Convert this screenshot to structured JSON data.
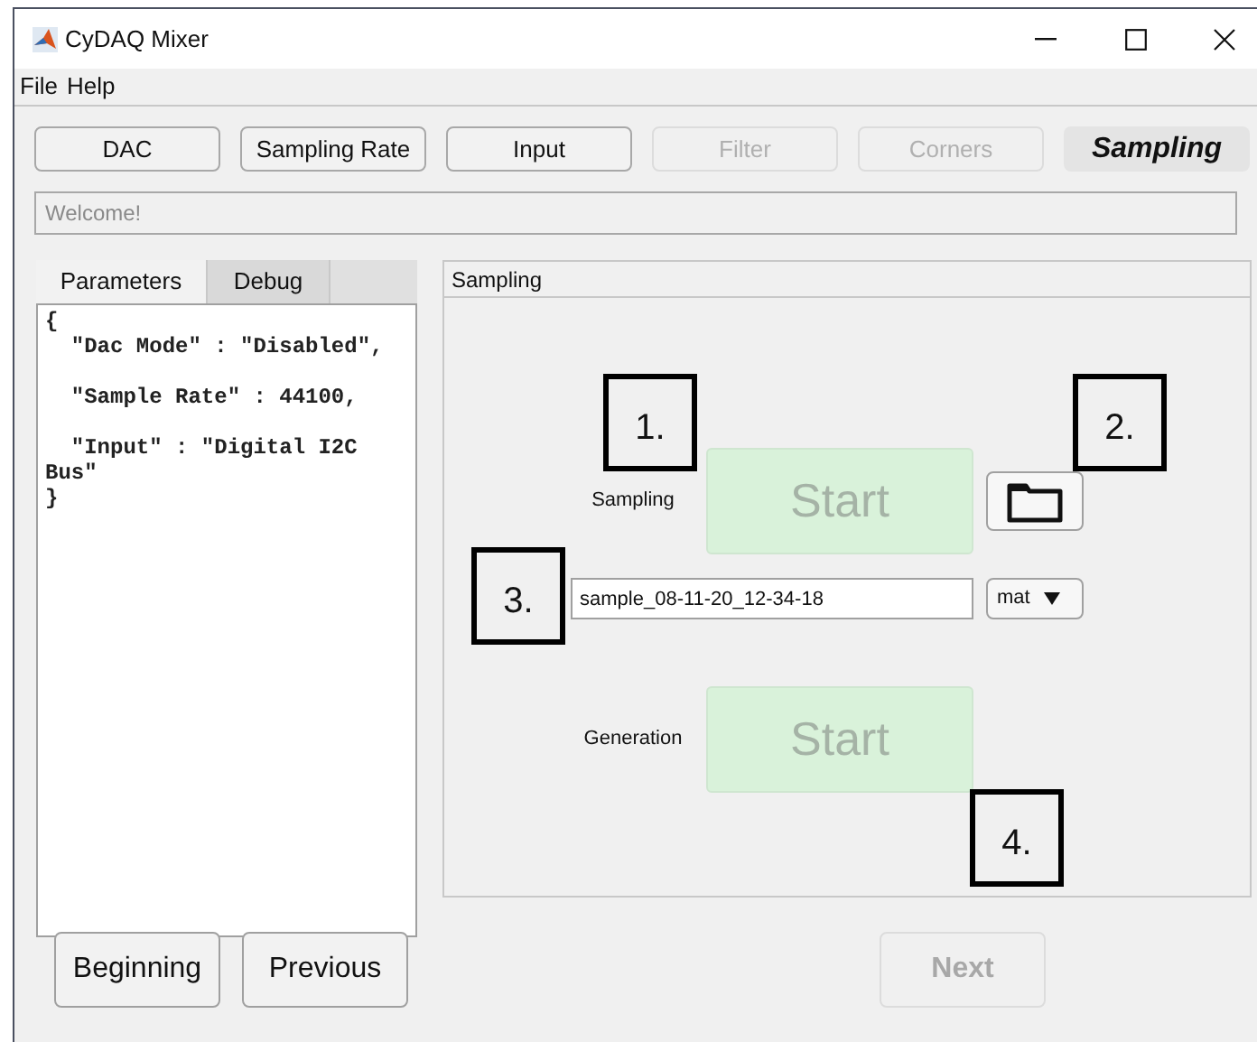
{
  "window": {
    "title": "CyDAQ Mixer"
  },
  "menu": [
    "File",
    "Help"
  ],
  "nav_tabs": [
    {
      "label": "DAC",
      "disabled": false,
      "selected": false
    },
    {
      "label": "Sampling Rate",
      "disabled": false,
      "selected": false
    },
    {
      "label": "Input",
      "disabled": false,
      "selected": false
    },
    {
      "label": "Filter",
      "disabled": true,
      "selected": false
    },
    {
      "label": "Corners",
      "disabled": true,
      "selected": false
    },
    {
      "label": "Sampling",
      "disabled": false,
      "selected": true
    }
  ],
  "status_field": {
    "value": "Welcome!"
  },
  "left_tabs": [
    {
      "label": "Parameters",
      "selected": true
    },
    {
      "label": "Debug",
      "selected": false
    }
  ],
  "parameters_text": "{\n  \"Dac Mode\" : \"Disabled\",\n\n  \"Sample Rate\" : 44100,\n\n  \"Input\" : \"Digital I2C Bus\"\n}",
  "sampling_panel": {
    "title": "Sampling",
    "sampling_label": "Sampling",
    "sampling_button": {
      "label": "Start",
      "disabled": true
    },
    "file_name": "sample_08-11-20_12-34-18",
    "format": "mat",
    "generation_label": "Generation",
    "generation_button": {
      "label": "Start",
      "disabled": true
    }
  },
  "annotations": [
    "1.",
    "2.",
    "3.",
    "4."
  ],
  "footer_buttons": [
    {
      "label": "Beginning",
      "disabled": false
    },
    {
      "label": "Previous",
      "disabled": false
    },
    {
      "label": "Next",
      "disabled": true
    }
  ]
}
